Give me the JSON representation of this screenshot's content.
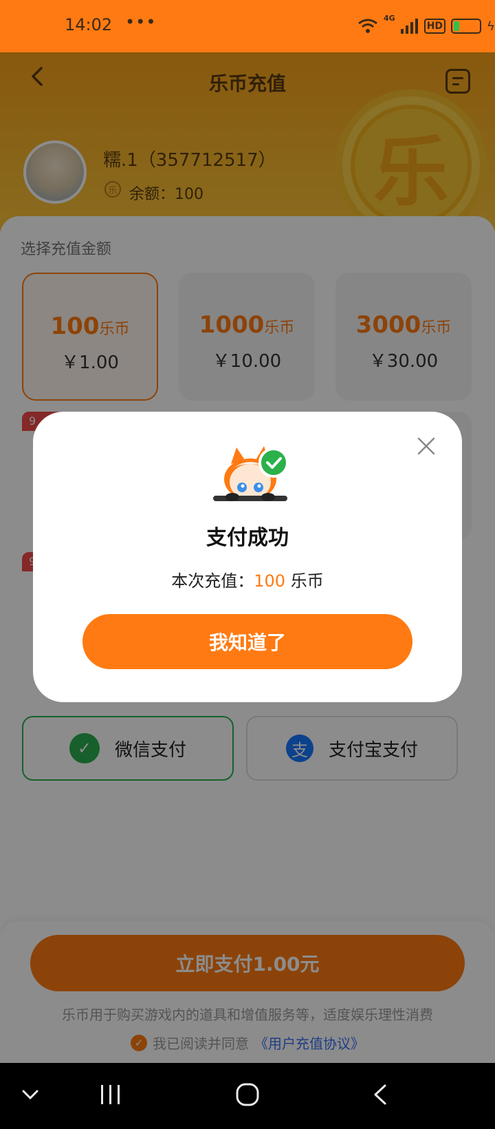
{
  "status_bar": {
    "time": "14:02",
    "dots": "•••",
    "network": "4G",
    "hd": "HD"
  },
  "header": {
    "title": "乐币充值",
    "coin_glyph": "乐",
    "user": {
      "name": "糯.1（357712517）",
      "balance": "余额：100",
      "balance_icon": "乐"
    }
  },
  "recharge": {
    "section_label": "选择充值金额",
    "options": [
      {
        "coins": "100",
        "unit": "乐币",
        "price": "￥1.00"
      },
      {
        "coins": "1000",
        "unit": "乐币",
        "price": "￥10.00"
      },
      {
        "coins": "3000",
        "unit": "乐币",
        "price": "￥30.00"
      }
    ],
    "tag_partial": "9",
    "tag_partial_2": "9"
  },
  "payment": {
    "wechat_label": "微信支付",
    "alipay_label": "支付宝支付",
    "alipay_icon": "支",
    "pay_now_label": "立即支付1.00元",
    "notice": "乐币用于购买游戏内的道具和增值服务等，适度娱乐理性消费",
    "agree_prefix": "我已阅读并同意",
    "agree_link": "《用户充值协议》"
  },
  "dialog": {
    "title": "支付成功",
    "message_prefix": "本次充值：",
    "amount": "100",
    "message_suffix": " 乐币",
    "confirm_label": "我知道了"
  },
  "colors": {
    "accent": "#ff7a12",
    "wechat": "#2aae4f",
    "alipay": "#1677ff",
    "success": "#2bb14a"
  }
}
